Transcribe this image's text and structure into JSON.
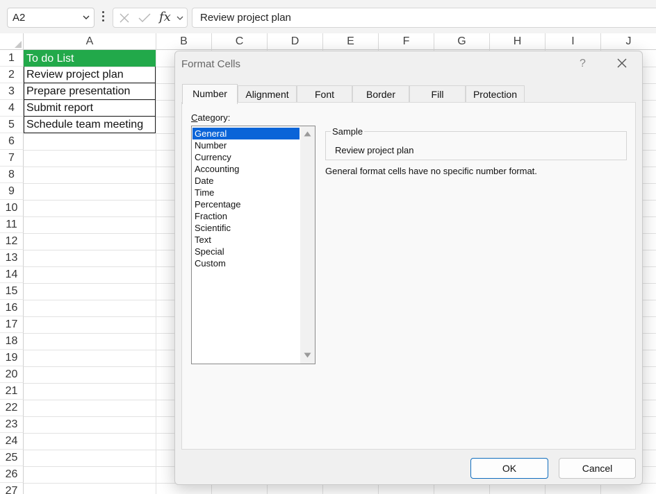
{
  "formula_bar": {
    "name_box": "A2",
    "fx_label": "fx",
    "formula": "Review project plan"
  },
  "grid": {
    "columns": [
      "A",
      "B",
      "C",
      "D",
      "E",
      "F",
      "G",
      "H",
      "I",
      "J"
    ],
    "rows": [
      "1",
      "2",
      "3",
      "4",
      "5",
      "6",
      "7",
      "8",
      "9",
      "10",
      "11",
      "12",
      "13",
      "14",
      "15",
      "16",
      "17",
      "18",
      "19",
      "20",
      "21",
      "22",
      "23",
      "24",
      "25",
      "26",
      "27"
    ],
    "cells_a": [
      "To do List",
      "Review project plan",
      "Prepare presentation",
      "Submit report",
      "Schedule team meeting"
    ],
    "header_fill_color": "#22a94a"
  },
  "dialog": {
    "title": "Format Cells",
    "help": "?",
    "tabs": [
      "Number",
      "Alignment",
      "Font",
      "Border",
      "Fill",
      "Protection"
    ],
    "active_tab": "Number",
    "category_label_accel": "C",
    "category_label_rest": "ategory:",
    "categories": [
      "General",
      "Number",
      "Currency",
      "Accounting",
      "Date",
      "Time",
      "Percentage",
      "Fraction",
      "Scientific",
      "Text",
      "Special",
      "Custom"
    ],
    "selected_category": "General",
    "sample_label": "Sample",
    "sample_value": "Review project plan",
    "description": "General format cells have no specific number format.",
    "ok_label": "OK",
    "cancel_label": "Cancel",
    "selection_color": "#0a64d8"
  }
}
